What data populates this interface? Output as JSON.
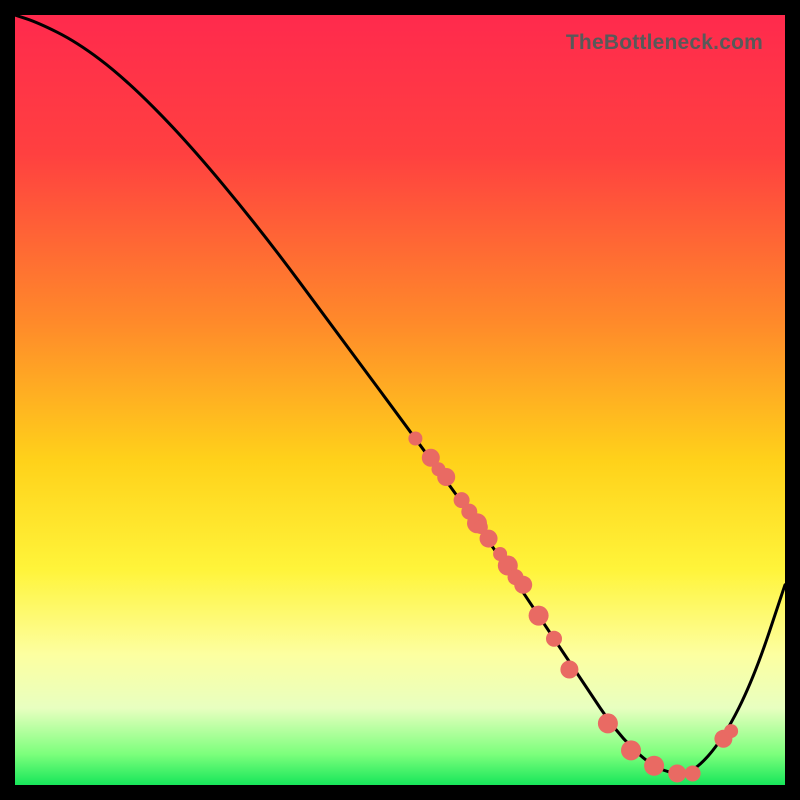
{
  "watermark": "TheBottleneck.com",
  "chart_data": {
    "type": "line",
    "title": "",
    "xlabel": "",
    "ylabel": "",
    "xlim": [
      0,
      100
    ],
    "ylim": [
      0,
      100
    ],
    "gradient_stops": [
      {
        "offset": 0.0,
        "color": "#ff2a4d"
      },
      {
        "offset": 0.18,
        "color": "#ff4040"
      },
      {
        "offset": 0.4,
        "color": "#ff8a2a"
      },
      {
        "offset": 0.58,
        "color": "#ffd21a"
      },
      {
        "offset": 0.72,
        "color": "#fff43a"
      },
      {
        "offset": 0.83,
        "color": "#fdffa0"
      },
      {
        "offset": 0.9,
        "color": "#e8ffc0"
      },
      {
        "offset": 0.96,
        "color": "#7cff7c"
      },
      {
        "offset": 1.0,
        "color": "#17e65a"
      }
    ],
    "series": [
      {
        "name": "bottleneck-curve",
        "x": [
          0,
          3,
          8,
          14,
          22,
          32,
          42,
          52,
          60,
          68,
          74,
          78,
          82,
          85,
          88,
          92,
          96,
          100
        ],
        "values": [
          100,
          99,
          96.5,
          92,
          84,
          72,
          58.5,
          45,
          34,
          22,
          13,
          7,
          3,
          1.5,
          1.5,
          6,
          14,
          26
        ]
      }
    ],
    "markers": {
      "name": "data-points",
      "color": "#e96a63",
      "x": [
        52,
        54,
        55,
        56,
        58,
        59,
        60,
        60.5,
        61.5,
        63,
        64,
        65,
        66,
        68,
        70,
        72,
        77,
        80,
        83,
        86,
        88,
        92,
        93
      ],
      "values": [
        45,
        42.5,
        41,
        40,
        37,
        35.5,
        34,
        33.5,
        32,
        30,
        28.5,
        27,
        26,
        22,
        19,
        15,
        8,
        4.5,
        2.5,
        1.5,
        1.5,
        6,
        7
      ],
      "radius": [
        7,
        9,
        7,
        9,
        8,
        8,
        10,
        7,
        9,
        7,
        10,
        8,
        9,
        10,
        8,
        9,
        10,
        10,
        10,
        9,
        8,
        9,
        7
      ]
    }
  }
}
